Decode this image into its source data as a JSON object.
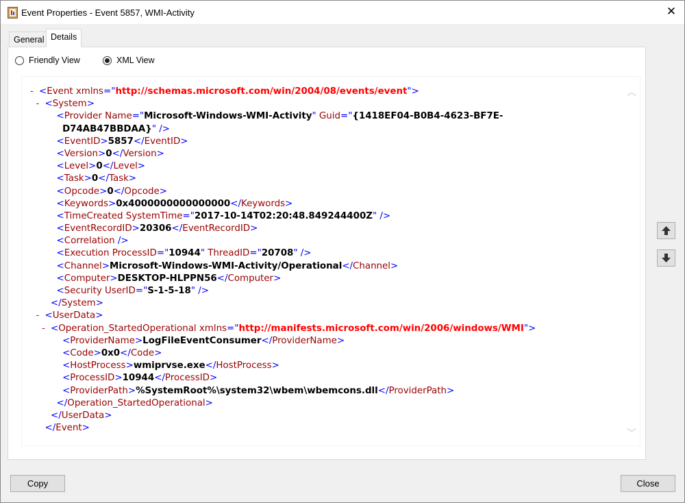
{
  "window": {
    "title": "Event Properties - Event 5857, WMI-Activity",
    "close_glyph": "✕"
  },
  "tabs": [
    {
      "label": "General",
      "active": false
    },
    {
      "label": "Details",
      "active": true
    }
  ],
  "view_options": {
    "friendly": {
      "label": "Friendly View",
      "checked": false
    },
    "xml": {
      "label": "XML View",
      "checked": true
    }
  },
  "xml_lines": [
    [
      [
        "c",
        "- "
      ],
      [
        "b",
        "<"
      ],
      [
        "t",
        "Event"
      ],
      [
        "a",
        " xmlns"
      ],
      [
        "b",
        "="
      ],
      [
        "q",
        "\""
      ],
      [
        "n",
        "http://schemas.microsoft.com/win/2004/08/events/event"
      ],
      [
        "q",
        "\""
      ],
      [
        "b",
        ">"
      ]
    ],
    [
      [
        "s",
        "  "
      ],
      [
        "c",
        "- "
      ],
      [
        "b",
        "<"
      ],
      [
        "t",
        "System"
      ],
      [
        "b",
        ">"
      ]
    ],
    [
      [
        "s",
        "      "
      ],
      [
        "b",
        "<"
      ],
      [
        "t",
        "Provider"
      ],
      [
        "a",
        " Name"
      ],
      [
        "b",
        "="
      ],
      [
        "q",
        "\""
      ],
      [
        "v",
        "Microsoft-Windows-WMI-Activity"
      ],
      [
        "q",
        "\""
      ],
      [
        "a",
        " Guid"
      ],
      [
        "b",
        "="
      ],
      [
        "q",
        "\""
      ],
      [
        "v",
        "{1418EF04-B0B4-4623-BF7E-"
      ]
    ],
    [
      [
        "s",
        "        "
      ],
      [
        "v",
        "D74AB47BBDAA}"
      ],
      [
        "q",
        "\""
      ],
      [
        "b",
        " />"
      ]
    ],
    [
      [
        "s",
        "      "
      ],
      [
        "b",
        "<"
      ],
      [
        "t",
        "EventID"
      ],
      [
        "b",
        ">"
      ],
      [
        "x",
        "5857"
      ],
      [
        "b",
        "</"
      ],
      [
        "t",
        "EventID"
      ],
      [
        "b",
        ">"
      ]
    ],
    [
      [
        "s",
        "      "
      ],
      [
        "b",
        "<"
      ],
      [
        "t",
        "Version"
      ],
      [
        "b",
        ">"
      ],
      [
        "x",
        "0"
      ],
      [
        "b",
        "</"
      ],
      [
        "t",
        "Version"
      ],
      [
        "b",
        ">"
      ]
    ],
    [
      [
        "s",
        "      "
      ],
      [
        "b",
        "<"
      ],
      [
        "t",
        "Level"
      ],
      [
        "b",
        ">"
      ],
      [
        "x",
        "0"
      ],
      [
        "b",
        "</"
      ],
      [
        "t",
        "Level"
      ],
      [
        "b",
        ">"
      ]
    ],
    [
      [
        "s",
        "      "
      ],
      [
        "b",
        "<"
      ],
      [
        "t",
        "Task"
      ],
      [
        "b",
        ">"
      ],
      [
        "x",
        "0"
      ],
      [
        "b",
        "</"
      ],
      [
        "t",
        "Task"
      ],
      [
        "b",
        ">"
      ]
    ],
    [
      [
        "s",
        "      "
      ],
      [
        "b",
        "<"
      ],
      [
        "t",
        "Opcode"
      ],
      [
        "b",
        ">"
      ],
      [
        "x",
        "0"
      ],
      [
        "b",
        "</"
      ],
      [
        "t",
        "Opcode"
      ],
      [
        "b",
        ">"
      ]
    ],
    [
      [
        "s",
        "      "
      ],
      [
        "b",
        "<"
      ],
      [
        "t",
        "Keywords"
      ],
      [
        "b",
        ">"
      ],
      [
        "x",
        "0x4000000000000000"
      ],
      [
        "b",
        "</"
      ],
      [
        "t",
        "Keywords"
      ],
      [
        "b",
        ">"
      ]
    ],
    [
      [
        "s",
        "      "
      ],
      [
        "b",
        "<"
      ],
      [
        "t",
        "TimeCreated"
      ],
      [
        "a",
        " SystemTime"
      ],
      [
        "b",
        "="
      ],
      [
        "q",
        "\""
      ],
      [
        "v",
        "2017-10-14T02:20:48.849244400Z"
      ],
      [
        "q",
        "\""
      ],
      [
        "b",
        " />"
      ]
    ],
    [
      [
        "s",
        "      "
      ],
      [
        "b",
        "<"
      ],
      [
        "t",
        "EventRecordID"
      ],
      [
        "b",
        ">"
      ],
      [
        "x",
        "20306"
      ],
      [
        "b",
        "</"
      ],
      [
        "t",
        "EventRecordID"
      ],
      [
        "b",
        ">"
      ]
    ],
    [
      [
        "s",
        "      "
      ],
      [
        "b",
        "<"
      ],
      [
        "t",
        "Correlation"
      ],
      [
        "b",
        " />"
      ]
    ],
    [
      [
        "s",
        "      "
      ],
      [
        "b",
        "<"
      ],
      [
        "t",
        "Execution"
      ],
      [
        "a",
        " ProcessID"
      ],
      [
        "b",
        "="
      ],
      [
        "q",
        "\""
      ],
      [
        "v",
        "10944"
      ],
      [
        "q",
        "\""
      ],
      [
        "a",
        " ThreadID"
      ],
      [
        "b",
        "="
      ],
      [
        "q",
        "\""
      ],
      [
        "v",
        "20708"
      ],
      [
        "q",
        "\""
      ],
      [
        "b",
        " />"
      ]
    ],
    [
      [
        "s",
        "      "
      ],
      [
        "b",
        "<"
      ],
      [
        "t",
        "Channel"
      ],
      [
        "b",
        ">"
      ],
      [
        "x",
        "Microsoft-Windows-WMI-Activity/Operational"
      ],
      [
        "b",
        "</"
      ],
      [
        "t",
        "Channel"
      ],
      [
        "b",
        ">"
      ]
    ],
    [
      [
        "s",
        "      "
      ],
      [
        "b",
        "<"
      ],
      [
        "t",
        "Computer"
      ],
      [
        "b",
        ">"
      ],
      [
        "x",
        "DESKTOP-HLPPN56"
      ],
      [
        "b",
        "</"
      ],
      [
        "t",
        "Computer"
      ],
      [
        "b",
        ">"
      ]
    ],
    [
      [
        "s",
        "      "
      ],
      [
        "b",
        "<"
      ],
      [
        "t",
        "Security"
      ],
      [
        "a",
        " UserID"
      ],
      [
        "b",
        "="
      ],
      [
        "q",
        "\""
      ],
      [
        "v",
        "S-1-5-18"
      ],
      [
        "q",
        "\""
      ],
      [
        "b",
        " />"
      ]
    ],
    [
      [
        "s",
        "    "
      ],
      [
        "b",
        "</"
      ],
      [
        "t",
        "System"
      ],
      [
        "b",
        ">"
      ]
    ],
    [
      [
        "s",
        "  "
      ],
      [
        "c",
        "- "
      ],
      [
        "b",
        "<"
      ],
      [
        "t",
        "UserData"
      ],
      [
        "b",
        ">"
      ]
    ],
    [
      [
        "s",
        "    "
      ],
      [
        "c",
        "- "
      ],
      [
        "b",
        "<"
      ],
      [
        "t",
        "Operation_StartedOperational"
      ],
      [
        "a",
        " xmlns"
      ],
      [
        "b",
        "="
      ],
      [
        "q",
        "\""
      ],
      [
        "n",
        "http://manifests.microsoft.com/win/2006/windows/WMI"
      ],
      [
        "q",
        "\""
      ],
      [
        "b",
        ">"
      ]
    ],
    [
      [
        "s",
        "        "
      ],
      [
        "b",
        "<"
      ],
      [
        "t",
        "ProviderName"
      ],
      [
        "b",
        ">"
      ],
      [
        "x",
        "LogFileEventConsumer"
      ],
      [
        "b",
        "</"
      ],
      [
        "t",
        "ProviderName"
      ],
      [
        "b",
        ">"
      ]
    ],
    [
      [
        "s",
        "        "
      ],
      [
        "b",
        "<"
      ],
      [
        "t",
        "Code"
      ],
      [
        "b",
        ">"
      ],
      [
        "x",
        "0x0"
      ],
      [
        "b",
        "</"
      ],
      [
        "t",
        "Code"
      ],
      [
        "b",
        ">"
      ]
    ],
    [
      [
        "s",
        "        "
      ],
      [
        "b",
        "<"
      ],
      [
        "t",
        "HostProcess"
      ],
      [
        "b",
        ">"
      ],
      [
        "x",
        "wmiprvse.exe"
      ],
      [
        "b",
        "</"
      ],
      [
        "t",
        "HostProcess"
      ],
      [
        "b",
        ">"
      ]
    ],
    [
      [
        "s",
        "        "
      ],
      [
        "b",
        "<"
      ],
      [
        "t",
        "ProcessID"
      ],
      [
        "b",
        ">"
      ],
      [
        "x",
        "10944"
      ],
      [
        "b",
        "</"
      ],
      [
        "t",
        "ProcessID"
      ],
      [
        "b",
        ">"
      ]
    ],
    [
      [
        "s",
        "        "
      ],
      [
        "b",
        "<"
      ],
      [
        "t",
        "ProviderPath"
      ],
      [
        "b",
        ">"
      ],
      [
        "x",
        "%SystemRoot%\\system32\\wbem\\wbemcons.dll"
      ],
      [
        "b",
        "</"
      ],
      [
        "t",
        "ProviderPath"
      ],
      [
        "b",
        ">"
      ]
    ],
    [
      [
        "s",
        "      "
      ],
      [
        "b",
        "</"
      ],
      [
        "t",
        "Operation_StartedOperational"
      ],
      [
        "b",
        ">"
      ]
    ],
    [
      [
        "s",
        "    "
      ],
      [
        "b",
        "</"
      ],
      [
        "t",
        "UserData"
      ],
      [
        "b",
        ">"
      ]
    ],
    [
      [
        "s",
        "  "
      ],
      [
        "b",
        "</"
      ],
      [
        "t",
        "Event"
      ],
      [
        "b",
        ">"
      ]
    ]
  ],
  "scroll": {
    "up_glyph": "︿",
    "down_glyph": "﹀"
  },
  "nav": {
    "up_icon": "arrow-up-icon",
    "down_icon": "arrow-down-icon"
  },
  "buttons": {
    "copy": "Copy",
    "close": "Close"
  },
  "colors": {
    "xml_bracket": "#0000ff",
    "xml_tag": "#990000",
    "xml_ns": "#ff0000",
    "collapse": "#e00000"
  }
}
